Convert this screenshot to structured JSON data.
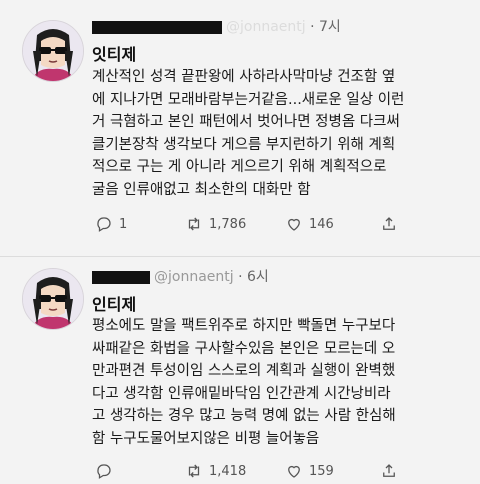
{
  "tweets": [
    {
      "handle_text": "@jonnaentj",
      "separator": "·",
      "time": "7시",
      "title": "잇티제",
      "body_lines": [
        "계산적인 성격 끝판왕에 사하라사막마냥 건조함 옆",
        "에 지나가면 모래바람부는거같음...새로운 일상 이런",
        "거 극혐하고 본인 패턴에서 벗어나면 정병옴 다크써",
        "클기본장착 생각보다 게으름 부지런하기 위해 계획",
        "적으로 구는 게 아니라 게으르기 위해 계획적으로",
        "굴음 인류애없고 최소한의 대화만 함"
      ],
      "reply_count": "1",
      "retweet_count": "1,786",
      "like_count": "146"
    },
    {
      "handle_text": "@jonnaentj",
      "separator": "·",
      "time": "6시",
      "title": "인티제",
      "body_lines": [
        "평소에도 말을 팩트위주로 하지만 빡돌면 누구보다",
        "싸패같은 화법을 구사할수있음 본인은 모르는데 오",
        "만과편견 투성이임 스스로의 계획과 실행이 완벽했",
        "다고 생각함 인류애밑바닥임 인간관계 시간낭비라",
        "고 생각하는 경우 많고 능력 명예 없는 사람 한심해",
        "함 누구도물어보지않은 비평 늘어놓음"
      ],
      "reply_count": "",
      "retweet_count": "1,418",
      "like_count": "159"
    }
  ],
  "colors": {
    "background": "#f3f3f3",
    "text": "#1b1b1b",
    "muted": "#666666",
    "redaction": "#111111"
  },
  "icons": {
    "reply": "reply-icon",
    "retweet": "retweet-icon",
    "like": "heart-icon",
    "share": "share-icon"
  }
}
